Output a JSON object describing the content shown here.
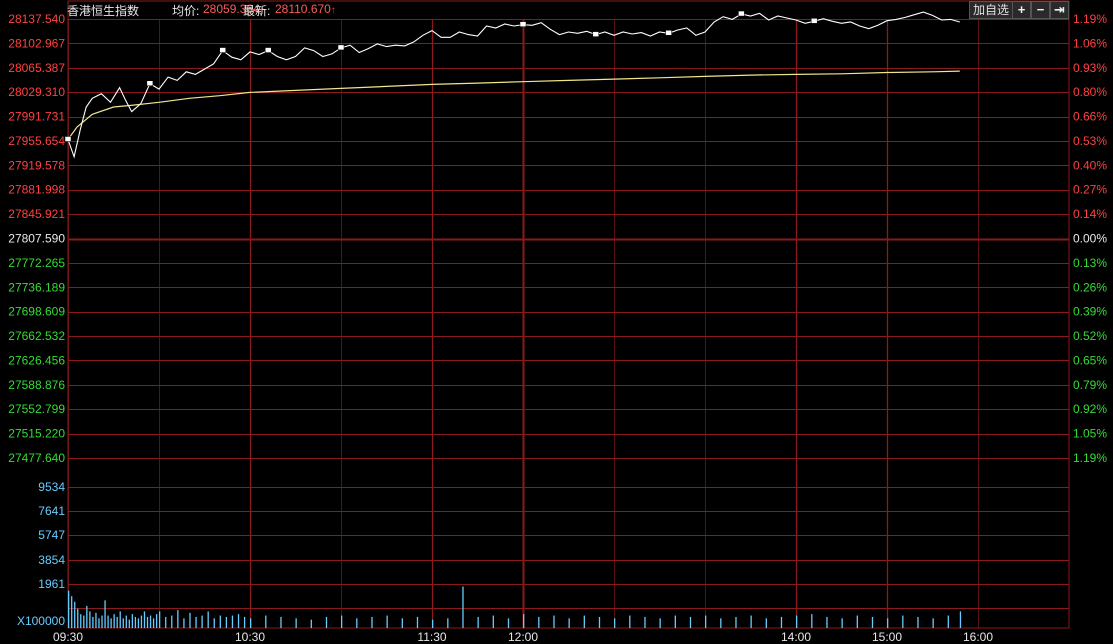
{
  "header": {
    "index_name": "香港恒生指数",
    "avg_label": "均价:",
    "avg_value": "28059.364",
    "latest_label": "最新:",
    "latest_value": "28110.670",
    "up_arrow": "↑",
    "add_watchlist_label": "加自选",
    "zoom_in_label": "+",
    "zoom_out_label": "−",
    "expand_label": "⇥"
  },
  "colors": {
    "background": "#000000",
    "grid": "#8b1a1a",
    "up_text": "#ff4040",
    "down_text": "#33dd33",
    "neutral_text": "#e8e8e8",
    "volume_axis_text": "#66ccff",
    "price_line": "#ffffff",
    "avg_line": "#f0e68c",
    "volume_bar": "#66ccff"
  },
  "chart_data": {
    "type": "line",
    "prev_close": 27807.59,
    "price_axis_labels": [
      "28137.540",
      "28102.967",
      "28065.387",
      "28029.310",
      "27991.731",
      "27955.654",
      "27919.578",
      "27881.998",
      "27845.921",
      "27807.590",
      "27772.265",
      "27736.189",
      "27698.609",
      "27662.532",
      "27626.456",
      "27588.876",
      "27552.799",
      "27515.220",
      "27477.640"
    ],
    "percent_axis_labels": [
      "1.19%",
      "1.06%",
      "0.93%",
      "0.80%",
      "0.66%",
      "0.53%",
      "0.40%",
      "0.27%",
      "0.14%",
      "0.00%",
      "0.13%",
      "0.26%",
      "0.39%",
      "0.52%",
      "0.65%",
      "0.79%",
      "0.92%",
      "1.05%",
      "1.19%"
    ],
    "volume_axis_labels": [
      "9534",
      "7641",
      "5747",
      "3854",
      "1961",
      "X100000"
    ],
    "time_labels": [
      "09:30",
      "10:30",
      "11:30",
      "12:00",
      "14:00",
      "15:00",
      "16:00"
    ],
    "price_series": {
      "x_minutes": [
        0,
        2,
        4,
        6,
        8,
        11,
        14,
        17,
        19,
        21,
        24,
        27,
        30,
        33,
        36,
        39,
        42,
        45,
        48,
        51,
        54,
        57,
        60,
        63,
        66,
        69,
        72,
        75,
        78,
        81,
        84,
        87,
        90,
        93,
        96,
        99,
        102,
        105,
        108,
        111,
        114,
        117,
        120,
        123,
        126,
        129,
        132,
        135,
        138,
        141,
        144,
        147,
        150,
        153,
        156,
        159,
        162,
        165,
        168,
        171,
        174,
        177,
        180,
        183,
        186,
        189,
        192,
        195,
        198,
        201,
        204,
        207,
        210,
        213,
        216,
        219,
        222,
        225,
        228,
        231,
        234,
        237,
        240,
        243,
        246,
        249,
        252,
        255,
        258,
        261,
        264,
        267,
        270,
        273,
        276,
        279,
        282,
        285,
        288,
        291,
        294
      ],
      "values": [
        27956,
        27930,
        27970,
        28005,
        28018,
        28025,
        28012,
        28034,
        28015,
        27998,
        28010,
        28040,
        28032,
        28050,
        28045,
        28058,
        28054,
        28062,
        28070,
        28090,
        28080,
        28076,
        28088,
        28084,
        28090,
        28081,
        28076,
        28081,
        28094,
        28090,
        28081,
        28085,
        28094,
        28098,
        28087,
        28093,
        28100,
        28096,
        28098,
        28097,
        28103,
        28113,
        28120,
        28110,
        28110,
        28118,
        28114,
        28112,
        28127,
        28124,
        28130,
        28127,
        28129,
        28128,
        28132,
        28122,
        28114,
        28118,
        28116,
        28119,
        28114,
        28118,
        28113,
        28118,
        28115,
        28117,
        28112,
        28118,
        28116,
        28121,
        28124,
        28113,
        28118,
        28133,
        28141,
        28137,
        28145,
        28142,
        28146,
        28136,
        28142,
        28139,
        28136,
        28131,
        28134,
        28138,
        28134,
        28131,
        28133,
        28127,
        28123,
        28128,
        28135,
        28137,
        28140,
        28144,
        28148,
        28143,
        28136,
        28137,
        28133
      ]
    },
    "avg_series": {
      "x_minutes": [
        0,
        3,
        8,
        15,
        20,
        30,
        40,
        50,
        60,
        75,
        90,
        105,
        120,
        135,
        150,
        165,
        180,
        195,
        210,
        225,
        240,
        255,
        270,
        285,
        294
      ],
      "values": [
        27956,
        27975,
        27994,
        28005,
        28007,
        28012,
        28018,
        28022,
        28027,
        28030,
        28033,
        28036,
        28039,
        28041,
        28043,
        28045,
        28047,
        28049,
        28051,
        28053,
        28054,
        28055,
        28057,
        28058,
        28059
      ]
    },
    "volume_series": {
      "x_minutes": [
        0,
        1,
        2,
        3,
        4,
        5,
        6,
        7,
        8,
        9,
        10,
        11,
        12,
        13,
        14,
        15,
        16,
        17,
        18,
        19,
        20,
        21,
        22,
        23,
        24,
        25,
        26,
        27,
        28,
        29,
        30,
        32,
        34,
        36,
        38,
        40,
        42,
        44,
        46,
        48,
        50,
        52,
        54,
        56,
        58,
        60,
        65,
        70,
        75,
        80,
        85,
        90,
        95,
        100,
        105,
        110,
        115,
        120,
        125,
        130,
        135,
        140,
        145,
        150,
        155,
        160,
        165,
        170,
        175,
        180,
        185,
        190,
        195,
        200,
        205,
        210,
        215,
        220,
        225,
        230,
        235,
        240,
        245,
        250,
        255,
        260,
        265,
        270,
        275,
        280,
        285,
        290,
        294
      ],
      "values": [
        2700,
        2300,
        1900,
        1400,
        1000,
        900,
        1600,
        1200,
        800,
        1100,
        700,
        900,
        2000,
        900,
        700,
        1000,
        800,
        1200,
        700,
        900,
        600,
        1000,
        800,
        700,
        900,
        1200,
        800,
        900,
        700,
        1000,
        1200,
        800,
        900,
        1300,
        700,
        1100,
        800,
        900,
        1200,
        700,
        900,
        800,
        900,
        1000,
        800,
        700,
        900,
        800,
        700,
        600,
        800,
        900,
        700,
        800,
        900,
        700,
        800,
        600,
        700,
        3000,
        800,
        900,
        700,
        1000,
        800,
        900,
        700,
        900,
        800,
        700,
        900,
        800,
        700,
        900,
        800,
        900,
        700,
        800,
        900,
        700,
        800,
        900,
        1000,
        800,
        700,
        900,
        800,
        700,
        900,
        800,
        700,
        900,
        1200
      ],
      "scale_max": 11427
    }
  }
}
